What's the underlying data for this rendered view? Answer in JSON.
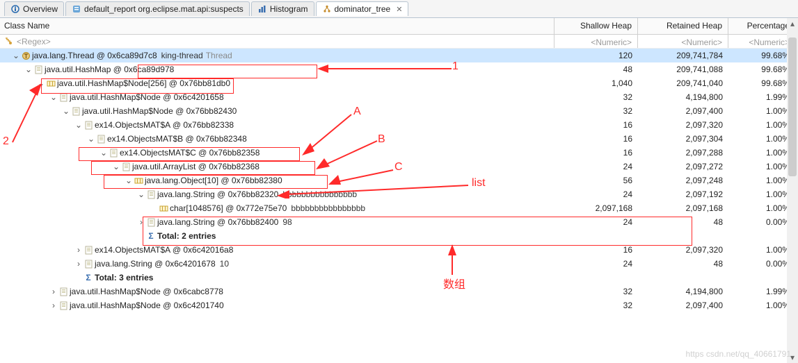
{
  "tabs": [
    {
      "icon": "info",
      "label": "Overview"
    },
    {
      "icon": "report",
      "label": "default_report  org.eclipse.mat.api:suspects"
    },
    {
      "icon": "histogram",
      "label": "Histogram"
    },
    {
      "icon": "domtree",
      "label": "dominator_tree"
    }
  ],
  "active_tab": 3,
  "columns": {
    "name": "Class Name",
    "shallow": "Shallow Heap",
    "retained": "Retained Heap",
    "percent": "Percentage"
  },
  "filters": {
    "name": "<Regex>",
    "shallow": "<Numeric>",
    "retained": "<Numeric>",
    "percent": "<Numeric>"
  },
  "rows": [
    {
      "indent": 0,
      "tw": "v",
      "icon": "thread",
      "text": "java.lang.Thread @ 0x6ca89d7c8",
      "suffix": "king-thread",
      "suffix2": "Thread",
      "sh": "120",
      "rh": "209,741,784",
      "pc": "99.68%",
      "sel": true
    },
    {
      "indent": 1,
      "tw": "v",
      "icon": "obj",
      "text": "java.util.HashMap @ 0x6ca89d978",
      "sh": "48",
      "rh": "209,741,088",
      "pc": "99.68%"
    },
    {
      "indent": 2,
      "tw": "v",
      "icon": "arr",
      "text": "java.util.HashMap$Node[256] @ 0x76bb81db0",
      "sh": "1,040",
      "rh": "209,741,040",
      "pc": "99.68%"
    },
    {
      "indent": 3,
      "tw": "v",
      "icon": "obj",
      "text": "java.util.HashMap$Node @ 0x6c4201658",
      "sh": "32",
      "rh": "4,194,800",
      "pc": "1.99%"
    },
    {
      "indent": 4,
      "tw": "v",
      "icon": "obj",
      "text": "java.util.HashMap$Node @ 0x76bb82430",
      "sh": "32",
      "rh": "2,097,400",
      "pc": "1.00%"
    },
    {
      "indent": 5,
      "tw": "v",
      "icon": "obj",
      "text": "ex14.ObjectsMAT$A @ 0x76bb82338",
      "sh": "16",
      "rh": "2,097,320",
      "pc": "1.00%"
    },
    {
      "indent": 6,
      "tw": "v",
      "icon": "obj",
      "text": "ex14.ObjectsMAT$B @ 0x76bb82348",
      "sh": "16",
      "rh": "2,097,304",
      "pc": "1.00%"
    },
    {
      "indent": 7,
      "tw": "v",
      "icon": "obj",
      "text": "ex14.ObjectsMAT$C @ 0x76bb82358",
      "sh": "16",
      "rh": "2,097,288",
      "pc": "1.00%"
    },
    {
      "indent": 8,
      "tw": "v",
      "icon": "obj",
      "text": "java.util.ArrayList @ 0x76bb82368",
      "sh": "24",
      "rh": "2,097,272",
      "pc": "1.00%"
    },
    {
      "indent": 9,
      "tw": "v",
      "icon": "arr",
      "text": "java.lang.Object[10] @ 0x76bb82380",
      "sh": "56",
      "rh": "2,097,248",
      "pc": "1.00%"
    },
    {
      "indent": 10,
      "tw": "v",
      "icon": "obj",
      "text": "java.lang.String @ 0x76bb82320",
      "suffix": "bbbbbbbbbbbbbbbb",
      "sh": "24",
      "rh": "2,097,192",
      "pc": "1.00%"
    },
    {
      "indent": 11,
      "tw": "",
      "icon": "arr",
      "text": "char[1048576] @ 0x772e75e70",
      "suffix": "bbbbbbbbbbbbbbbb",
      "sh": "2,097,168",
      "rh": "2,097,168",
      "pc": "1.00%"
    },
    {
      "indent": 10,
      "tw": ">",
      "icon": "obj",
      "text": "java.lang.String @ 0x76bb82400",
      "suffix": "98",
      "sh": "24",
      "rh": "48",
      "pc": "0.00%"
    },
    {
      "indent": 10,
      "tw": "",
      "icon": "sigma",
      "text": "Total: 2 entries",
      "bold": true,
      "sh": "",
      "rh": "",
      "pc": ""
    },
    {
      "indent": 5,
      "tw": ">",
      "icon": "obj",
      "text": "ex14.ObjectsMAT$A @ 0x6c42016a8",
      "sh": "16",
      "rh": "2,097,320",
      "pc": "1.00%"
    },
    {
      "indent": 5,
      "tw": ">",
      "icon": "obj",
      "text": "java.lang.String @ 0x6c4201678",
      "suffix": "10",
      "sh": "24",
      "rh": "48",
      "pc": "0.00%"
    },
    {
      "indent": 5,
      "tw": "",
      "icon": "sigma",
      "text": "Total: 3 entries",
      "bold": true,
      "sh": "",
      "rh": "",
      "pc": ""
    },
    {
      "indent": 3,
      "tw": ">",
      "icon": "obj",
      "text": "java.util.HashMap$Node @ 0x6cabc8778",
      "sh": "32",
      "rh": "4,194,800",
      "pc": "1.99%"
    },
    {
      "indent": 3,
      "tw": ">",
      "icon": "obj",
      "text": "java.util.HashMap$Node @ 0x6c4201740",
      "sh": "32",
      "rh": "2,097,400",
      "pc": "1.00%"
    }
  ],
  "annotations": {
    "labels": {
      "one": "1",
      "two": "2",
      "A": "A",
      "B": "B",
      "C": "C",
      "list": "list",
      "array": "数组"
    },
    "watermark": "https    csdn.net/qq_40661791"
  }
}
